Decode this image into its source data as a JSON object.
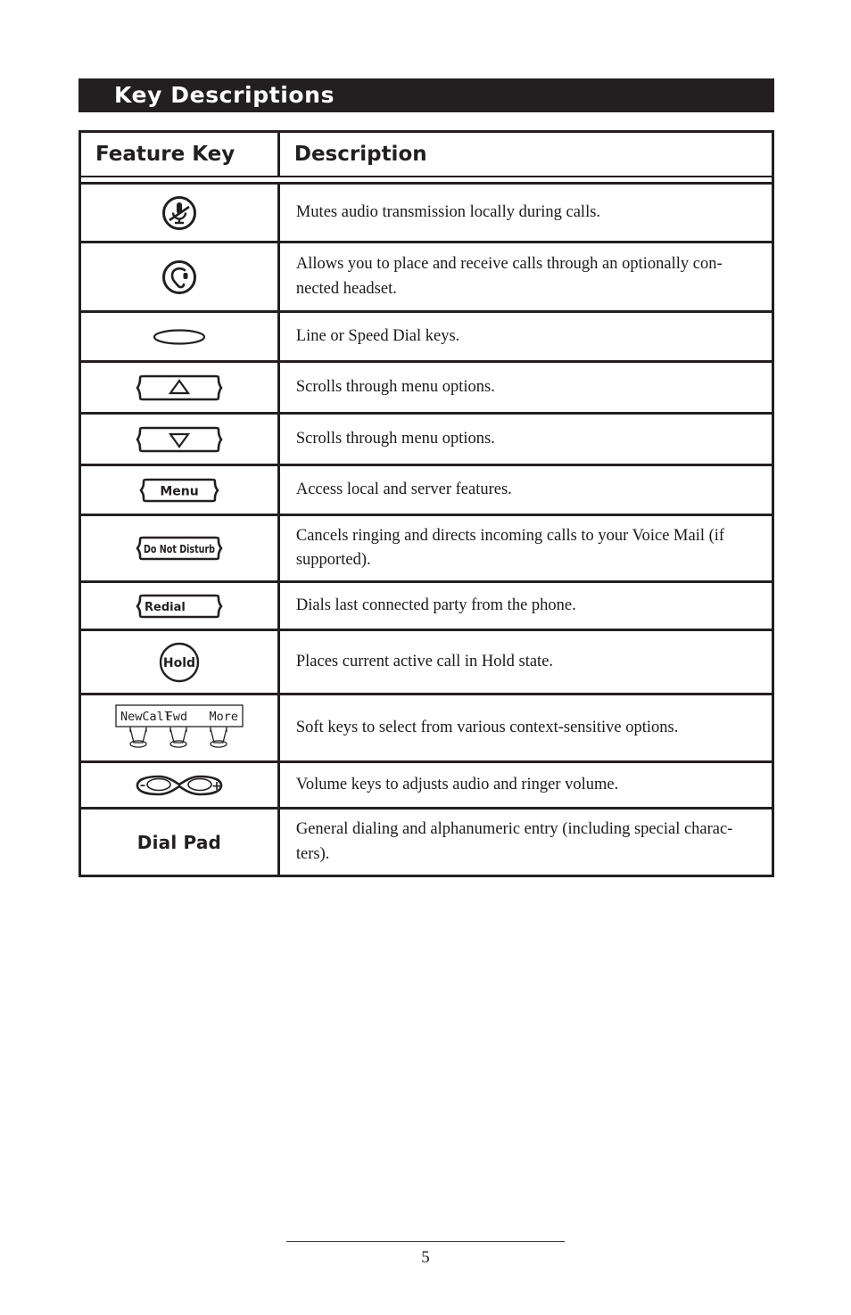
{
  "header": {
    "title": "Key Descriptions"
  },
  "table": {
    "columns": [
      "Feature Key",
      "Description"
    ],
    "rows": [
      {
        "key_icon": "mute-key-icon",
        "key_label": "",
        "description": "Mutes audio transmission locally during calls."
      },
      {
        "key_icon": "headset-key-icon",
        "key_label": "",
        "description": "Allows you to place and receive calls through an optionally con-nected headset."
      },
      {
        "key_icon": "line-key-icon",
        "key_label": "",
        "description": "Line or Speed Dial keys."
      },
      {
        "key_icon": "scroll-up-key-icon",
        "key_label": "",
        "description": "Scrolls through menu options."
      },
      {
        "key_icon": "scroll-down-key-icon",
        "key_label": "",
        "description": "Scrolls through menu options."
      },
      {
        "key_icon": "menu-key-icon",
        "key_label": "Menu",
        "description": "Access local and server features."
      },
      {
        "key_icon": "do-not-disturb-key-icon",
        "key_label": "Do Not Disturb",
        "description": "Cancels ringing and directs incoming calls to your Voice Mail (if supported)."
      },
      {
        "key_icon": "redial-key-icon",
        "key_label": "Redial",
        "description": "Dials last connected party from the phone."
      },
      {
        "key_icon": "hold-key-icon",
        "key_label": "Hold",
        "description": "Places current active call in Hold state."
      },
      {
        "key_icon": "soft-keys-icon",
        "key_label": "",
        "soft_key_labels": [
          "NewCall",
          "Fwd",
          "More"
        ],
        "description": "Soft keys to select from various context-sensitive options."
      },
      {
        "key_icon": "volume-key-icon",
        "key_label": "",
        "volume_minus": "–",
        "volume_plus": "+",
        "description": "Volume keys to adjusts audio and ringer volume."
      },
      {
        "key_icon": "dial-pad-label",
        "key_label": "Dial Pad",
        "description": "General dialing and alphanumeric entry (including special charac-ters)."
      }
    ]
  },
  "footer": {
    "page_number": "5"
  },
  "colors": {
    "ink": "#231f20",
    "text": "#1a1a1a",
    "paper": "#ffffff"
  }
}
